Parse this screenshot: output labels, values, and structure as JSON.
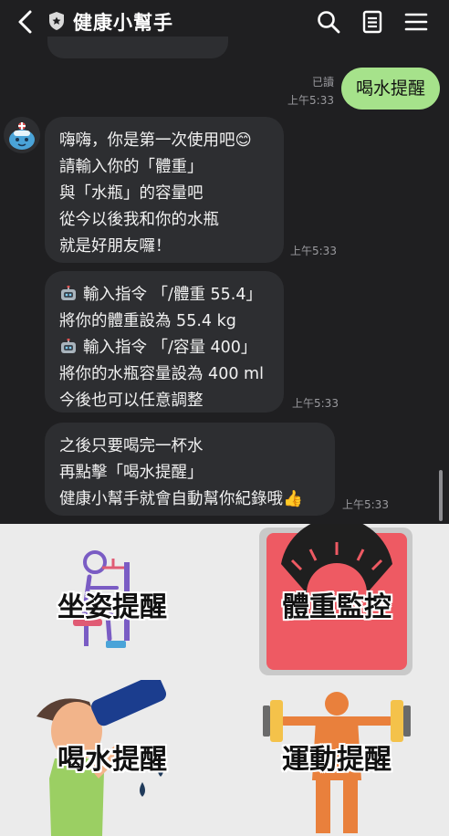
{
  "header": {
    "title": "健康小幫手",
    "icons": [
      "chevron-left-icon",
      "shield-icon",
      "search-icon",
      "note-icon",
      "menu-icon"
    ]
  },
  "outgoing": {
    "read_label": "已讀",
    "time": "上午5:33",
    "text": "喝水提醒"
  },
  "messages": [
    {
      "lines": [
        "嗨嗨，你是第一次使用吧😊",
        "請輸入你的「體重」",
        "與「水瓶」的容量吧",
        "從今以後我和你的水瓶",
        "就是好朋友囉！"
      ],
      "time": "上午5:33"
    },
    {
      "lines": [
        "輸入指令 「/體重 55.4」",
        "將你的體重設為 55.4 kg",
        "輸入指令 「/容量 400」",
        "將你的水瓶容量設為 400 ml",
        "今後也可以任意調整"
      ],
      "time": "上午5:33"
    },
    {
      "lines": [
        "之後只要喝完一杯水",
        "再點擊「喝水提醒」",
        "健康小幫手就會自動幫你紀錄哦👍"
      ],
      "time": "上午5:33"
    }
  ],
  "rich_menu": {
    "items": [
      {
        "label": "坐姿提醒",
        "icon": "desk-posture-icon"
      },
      {
        "label": "體重監控",
        "icon": "scale-icon"
      },
      {
        "label": "喝水提醒",
        "icon": "drinking-water-icon"
      },
      {
        "label": "運動提醒",
        "icon": "dumbbell-exercise-icon"
      }
    ]
  },
  "colors": {
    "background": "#1f1f21",
    "bubble_in": "#2d2e31",
    "bubble_out": "#a6e28b",
    "rich_menu_bg": "#ebebeb",
    "scale_red": "#ee5a63"
  }
}
